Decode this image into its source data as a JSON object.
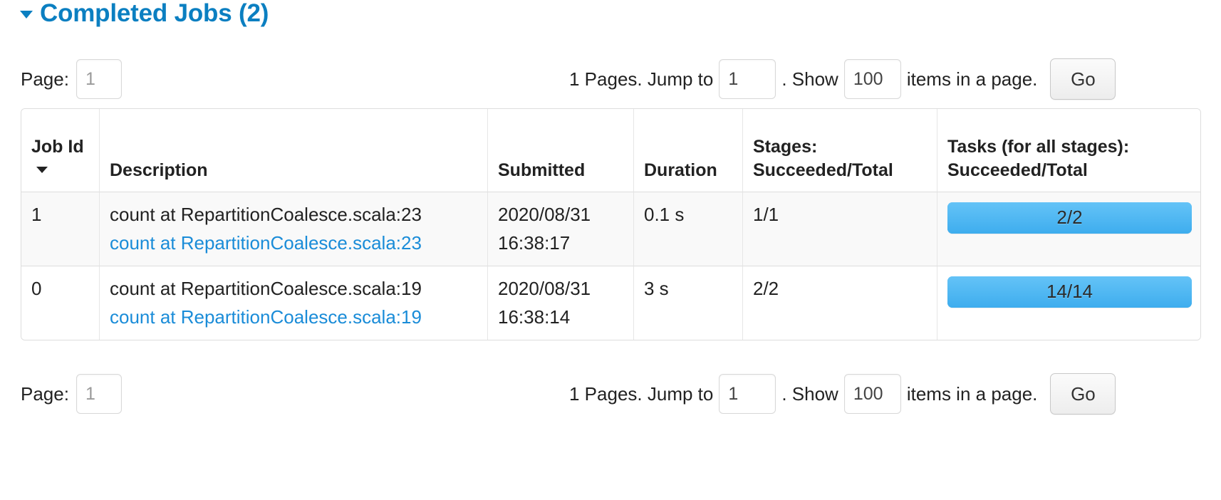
{
  "header": {
    "title": "Completed Jobs (2)",
    "collapse_icon": "caret-down-icon"
  },
  "pagination_top": {
    "page_label": "Page:",
    "page_value": "1",
    "pages_text": "1 Pages. Jump to",
    "jump_value": "1",
    "show_text": ". Show",
    "items_value": "100",
    "items_suffix": "items in a page.",
    "go_label": "Go"
  },
  "pagination_bottom": {
    "page_label": "Page:",
    "page_value": "1",
    "pages_text": "1 Pages. Jump to",
    "jump_value": "1",
    "show_text": ". Show",
    "items_value": "100",
    "items_suffix": "items in a page.",
    "go_label": "Go"
  },
  "table": {
    "columns": [
      {
        "label": "Job Id",
        "sorted": "desc",
        "sort_icon": "caret-down-icon"
      },
      {
        "label": "Description"
      },
      {
        "label": "Submitted"
      },
      {
        "label": "Duration"
      },
      {
        "label_line1": "Stages:",
        "label_line2": "Succeeded/Total"
      },
      {
        "label_line1": "Tasks (for all stages):",
        "label_line2": "Succeeded/Total"
      }
    ],
    "rows": [
      {
        "job_id": "1",
        "description": "count at RepartitionCoalesce.scala:23",
        "description_link": "count at RepartitionCoalesce.scala:23",
        "submitted_date": "2020/08/31",
        "submitted_time": "16:38:17",
        "duration": "0.1 s",
        "stages": "1/1",
        "tasks_label": "2/2",
        "tasks_percent": 100
      },
      {
        "job_id": "0",
        "description": "count at RepartitionCoalesce.scala:19",
        "description_link": "count at RepartitionCoalesce.scala:19",
        "submitted_date": "2020/08/31",
        "submitted_time": "16:38:14",
        "duration": "3 s",
        "stages": "2/2",
        "tasks_label": "14/14",
        "tasks_percent": 100
      }
    ]
  },
  "colors": {
    "title_blue": "#0b7fc1",
    "link_blue": "#1a8cd8",
    "progress_blue": "#5cb9f5",
    "row_alt_bg": "#f9f9f9",
    "border": "#dddddd"
  }
}
